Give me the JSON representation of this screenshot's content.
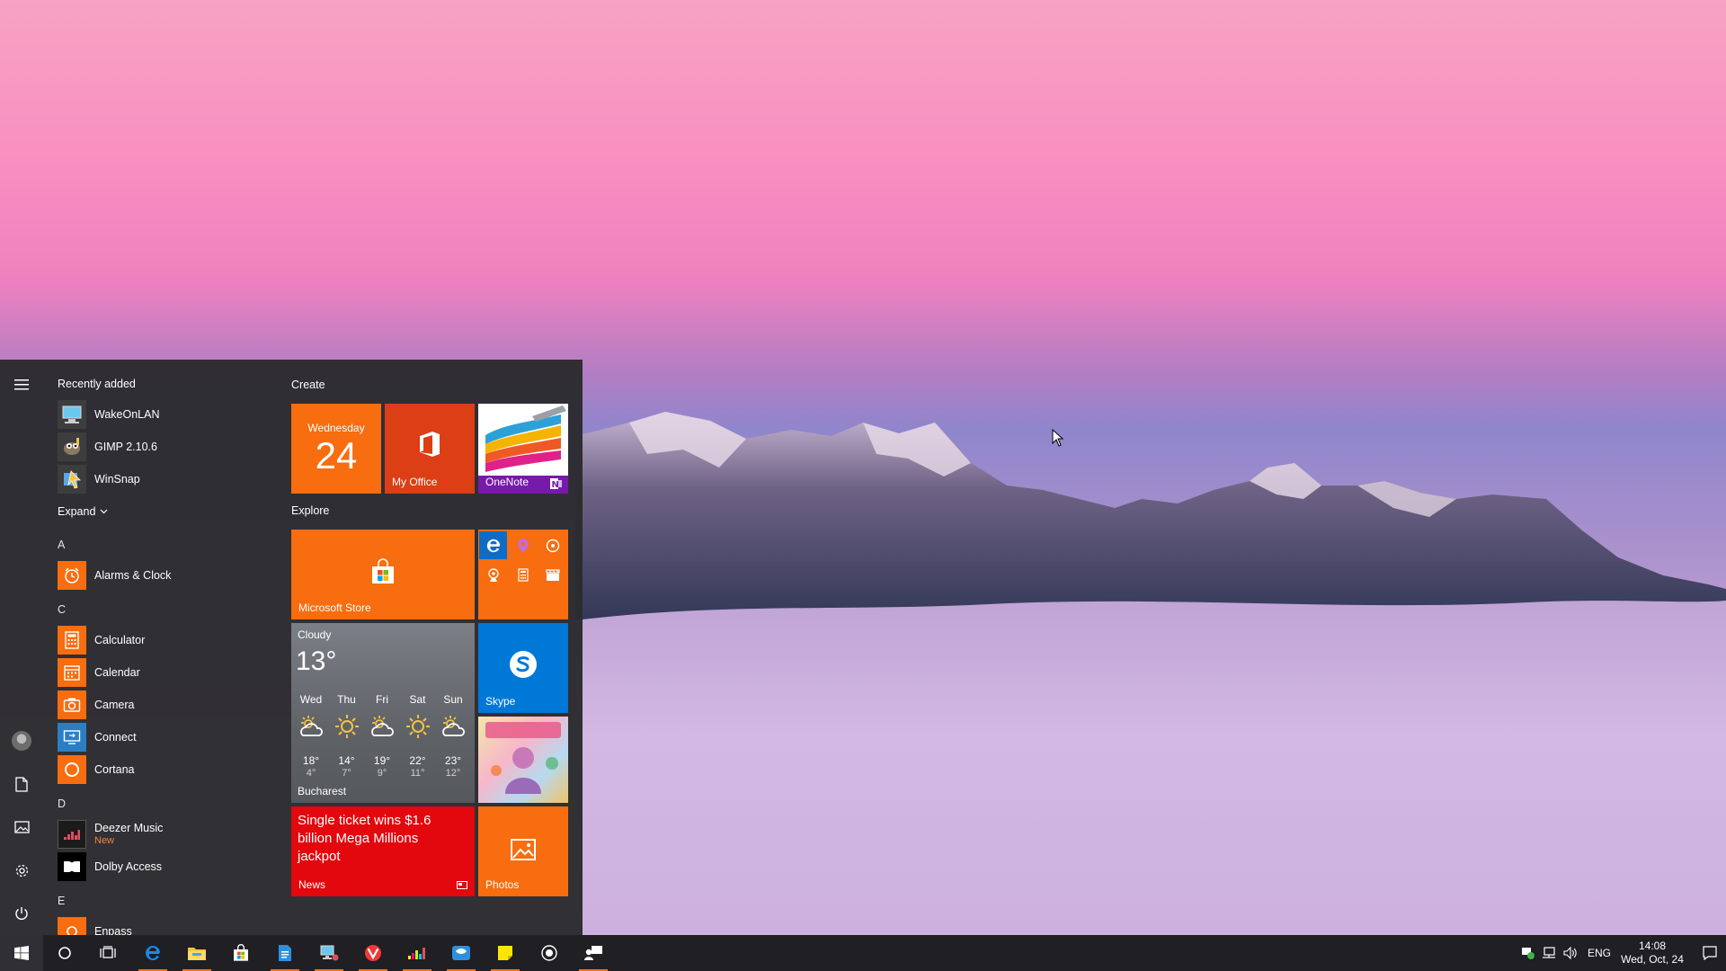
{
  "start_menu": {
    "recently_added_title": "Recently added",
    "recent_apps": [
      {
        "label": "WakeOnLAN",
        "icon": "network-computer-icon"
      },
      {
        "label": "GIMP 2.10.6",
        "icon": "gimp-icon"
      },
      {
        "label": "WinSnap",
        "icon": "winsnap-icon"
      }
    ],
    "expand_label": "Expand",
    "letters": {
      "a": "A",
      "c": "C",
      "d": "D",
      "e": "E"
    },
    "apps": {
      "alarms": "Alarms & Clock",
      "calculator": "Calculator",
      "calendar": "Calendar",
      "camera": "Camera",
      "connect": "Connect",
      "cortana": "Cortana",
      "deezer": "Deezer Music",
      "deezer_sub": "New",
      "dolby": "Dolby Access",
      "enpass": "Enpass"
    },
    "tiles": {
      "create_title": "Create",
      "explore_title": "Explore",
      "calendar_day": "Wednesday",
      "calendar_date": "24",
      "office_label": "My Office",
      "onenote_label": "OneNote",
      "store_label": "Microsoft Store",
      "skype_label": "Skype",
      "news_headline": "Single ticket wins $1.6 billion Mega Millions jackpot",
      "news_label": "News",
      "photos_label": "Photos",
      "weather": {
        "condition": "Cloudy",
        "temp": "13°",
        "city": "Bucharest",
        "days": [
          {
            "day": "Wed",
            "hi": "18°",
            "lo": "4°",
            "sym": "partly-cloudy"
          },
          {
            "day": "Thu",
            "hi": "14°",
            "lo": "7°",
            "sym": "sunny"
          },
          {
            "day": "Fri",
            "hi": "19°",
            "lo": "9°",
            "sym": "partly-cloudy"
          },
          {
            "day": "Sat",
            "hi": "22°",
            "lo": "11°",
            "sym": "sunny"
          },
          {
            "day": "Sun",
            "hi": "23°",
            "lo": "12°",
            "sym": "partly-cloudy"
          }
        ]
      }
    }
  },
  "taskbar": {
    "language": "ENG",
    "time": "14:08",
    "date": "Wed, Oct, 24"
  },
  "colors": {
    "accent": "#f76d0f",
    "menu_bg": "#2b2b2e",
    "taskbar_bg": "#1f1f24",
    "news_red": "#e3070e",
    "skype_blue": "#0078d7"
  }
}
